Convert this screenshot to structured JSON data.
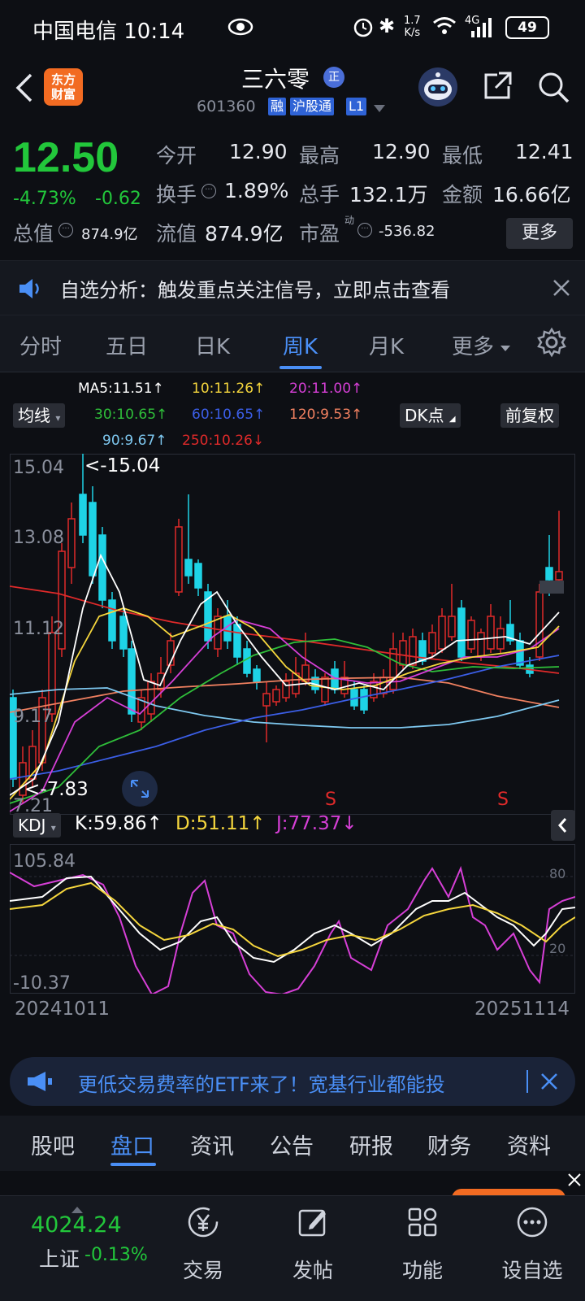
{
  "status_bar": {
    "carrier_time": "中国电信 10:14",
    "net_speed_top": "1.7",
    "net_speed_unit": "K/s",
    "signal": "4G",
    "battery": "49"
  },
  "header": {
    "logo_line1": "东方",
    "logo_line2": "财富",
    "title": "三六零",
    "title_badge": "正",
    "code": "601360",
    "tags": [
      "融",
      "沪股通",
      "L1"
    ]
  },
  "quote": {
    "price": "12.50",
    "change_pct": "-4.73%",
    "change": "-0.62",
    "open_label": "今开",
    "open": "12.90",
    "high_label": "最高",
    "high": "12.90",
    "low_label": "最低",
    "low": "12.41",
    "turnover_label": "换手",
    "turnover": "1.89%",
    "volume_label": "总手",
    "volume": "132.1万",
    "amount_label": "金额",
    "amount": "16.66亿",
    "mcap_label": "总值",
    "mcap": "874.9亿",
    "float_label": "流值",
    "float": "874.9亿",
    "pe_label": "市盈",
    "pe_sup": "动",
    "pe": "-536.82",
    "more_label": "更多"
  },
  "notice": {
    "text": "自选分析：触发重点关注信号，立即点击查看"
  },
  "tabs": [
    "分时",
    "五日",
    "日K",
    "周K",
    "月K",
    "更多"
  ],
  "chart_controls": {
    "ma_button": "均线",
    "dk_button": "DK点",
    "adjust_button": "前复权",
    "kdj_button": "KDJ"
  },
  "ma_legend": [
    {
      "text": "MA5:11.51↑",
      "color": "#ffffff"
    },
    {
      "text": "10:11.26↑",
      "color": "#f5d63d"
    },
    {
      "text": "20:11.00↑",
      "color": "#d63fd6"
    },
    {
      "text": "30:10.65↑",
      "color": "#2fbf3a"
    },
    {
      "text": "60:10.65↑",
      "color": "#3b5ee6"
    },
    {
      "text": "120:9.53↑",
      "color": "#f08060"
    },
    {
      "text": "90:9.67↑",
      "color": "#7ec8f0"
    },
    {
      "text": "250:10.26↓",
      "color": "#e02a2a"
    }
  ],
  "kline_axis": {
    "y_labels": [
      "15.04",
      "13.08",
      "11.12",
      "9.17",
      "7.21"
    ],
    "max_marker": "<-15.04",
    "min_marker": "<-7.83",
    "signals": [
      "S",
      "S"
    ]
  },
  "kdj": {
    "k": "K:59.86↑",
    "d": "D:51.11↑",
    "j": "J:77.37↓",
    "y_top": "105.84",
    "y_bottom": "-10.37",
    "ref_80": "80",
    "ref_20": "20"
  },
  "date_range": {
    "start": "20241011",
    "end": "20251114"
  },
  "banner": {
    "text": "更低交易费率的ETF来了！宽基行业都能投"
  },
  "bottom_tabs": [
    "股吧",
    "盘口",
    "资讯",
    "公告",
    "研报",
    "财务",
    "资料"
  ],
  "dock": {
    "index_value": "4024.24",
    "index_name": "上证",
    "index_change": "-0.13%",
    "items": [
      "交易",
      "发帖",
      "功能",
      "设自选"
    ]
  },
  "colors": {
    "up": "#e02a2a",
    "down": "#22c73b",
    "accent": "#4a8ff6",
    "candle_down": "#1ed3e6"
  }
}
